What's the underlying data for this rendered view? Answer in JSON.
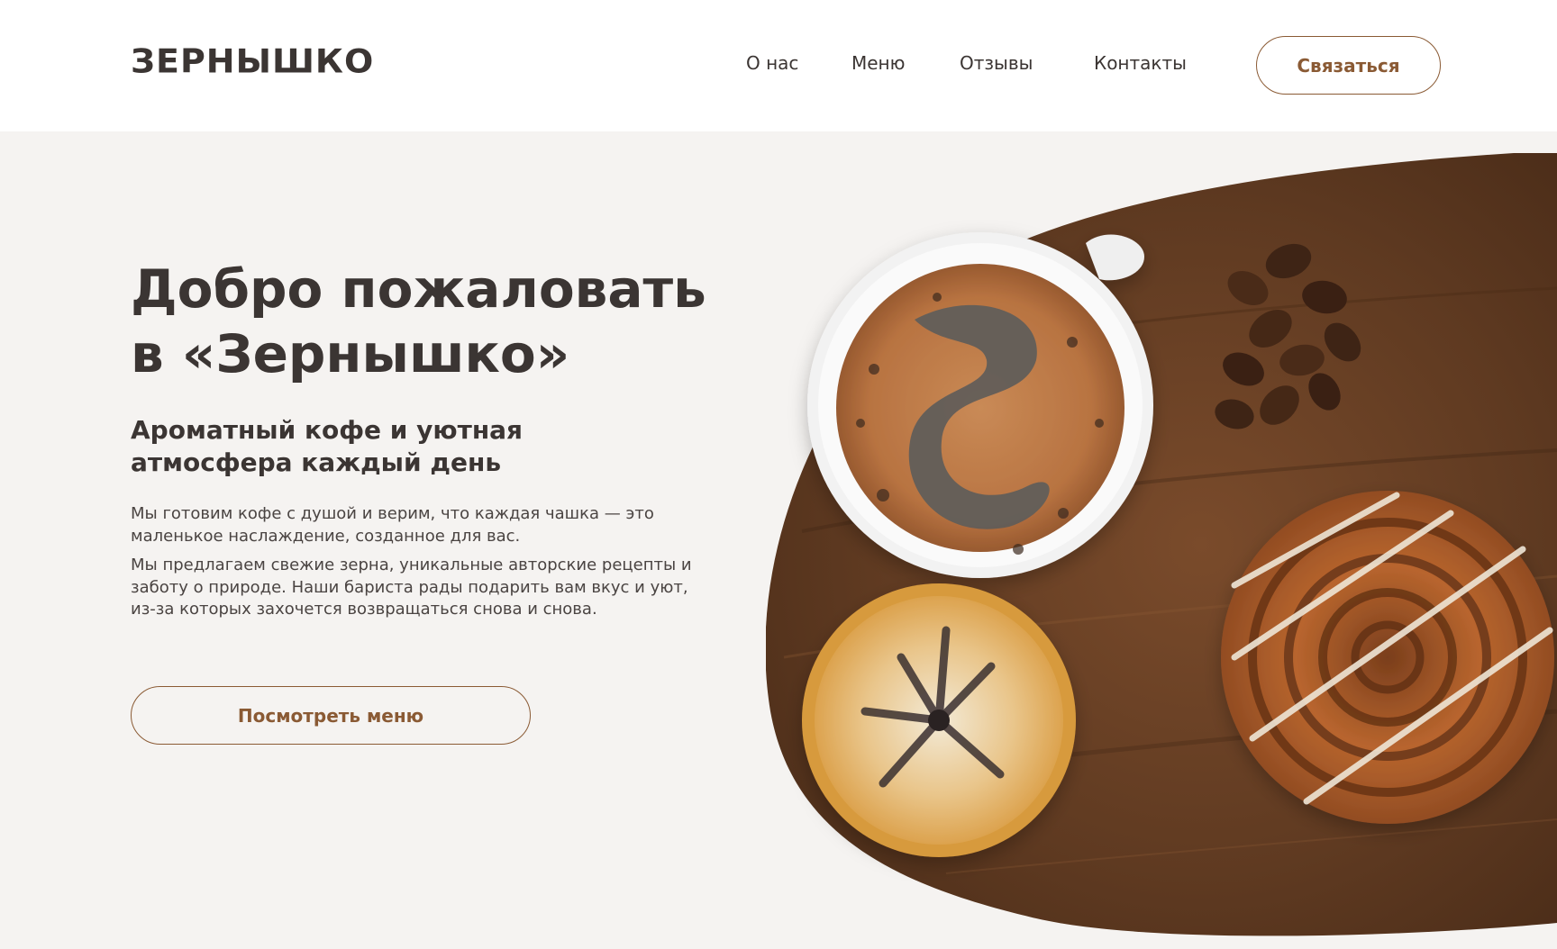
{
  "brand": {
    "logo_text": "ЗЕРНЫШКО"
  },
  "nav": {
    "items": [
      {
        "label": "О нас"
      },
      {
        "label": "Меню"
      },
      {
        "label": "Отзывы"
      },
      {
        "label": "Контакты"
      }
    ],
    "cta_label": "Связаться"
  },
  "hero": {
    "title_line1": "Добро пожаловать",
    "title_line2": "в «Зернышко»",
    "subtitle_line1": "Ароматный кофе и уютная",
    "subtitle_line2": "атмосфера каждый день",
    "paragraph1": "Мы готовим кофе с душой и верим, что каждая чашка — это маленькое наслаждение, созданное для вас.",
    "paragraph2": "Мы предлагаем свежие зерна, уникальные авторские рецепты и заботу о природе. Наши бариста рады подарить вам вкус и уют, из-за которых захочется возвращаться снова и снова.",
    "menu_button_label": "Посмотреть меню"
  },
  "colors": {
    "accent": "#8a5a34",
    "text_dark": "#3b3533",
    "background": "#f5f3f1",
    "header_bg": "#ffffff",
    "wood": "#6b4326"
  },
  "illustration": {
    "items": [
      "wood-board",
      "coffee-cup-icon",
      "coffee-beans-icon",
      "cinnamon-roll-icon",
      "pastry-icon"
    ]
  }
}
